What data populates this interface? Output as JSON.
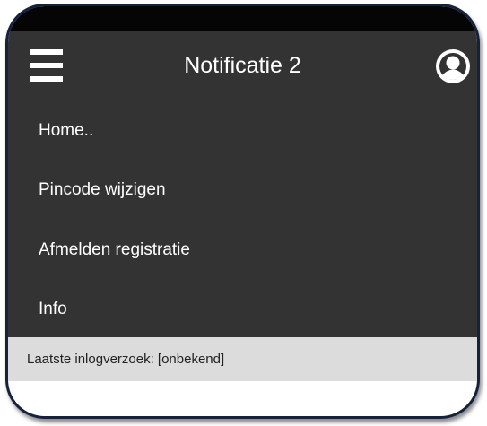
{
  "header": {
    "title": "Notificatie 2",
    "menu_icon": "hamburger-menu-icon",
    "account_icon": "user-account-icon"
  },
  "menu": {
    "items": [
      {
        "label": "Home.."
      },
      {
        "label": "Pincode wijzigen"
      },
      {
        "label": "Afmelden registratie"
      },
      {
        "label": "Info"
      }
    ]
  },
  "footer": {
    "status_text": "Laatste inlogverzoek: [onbekend]"
  },
  "colors": {
    "appbar": "#333333",
    "frame_border": "#16213e",
    "status_bg": "#dcdcdc"
  }
}
